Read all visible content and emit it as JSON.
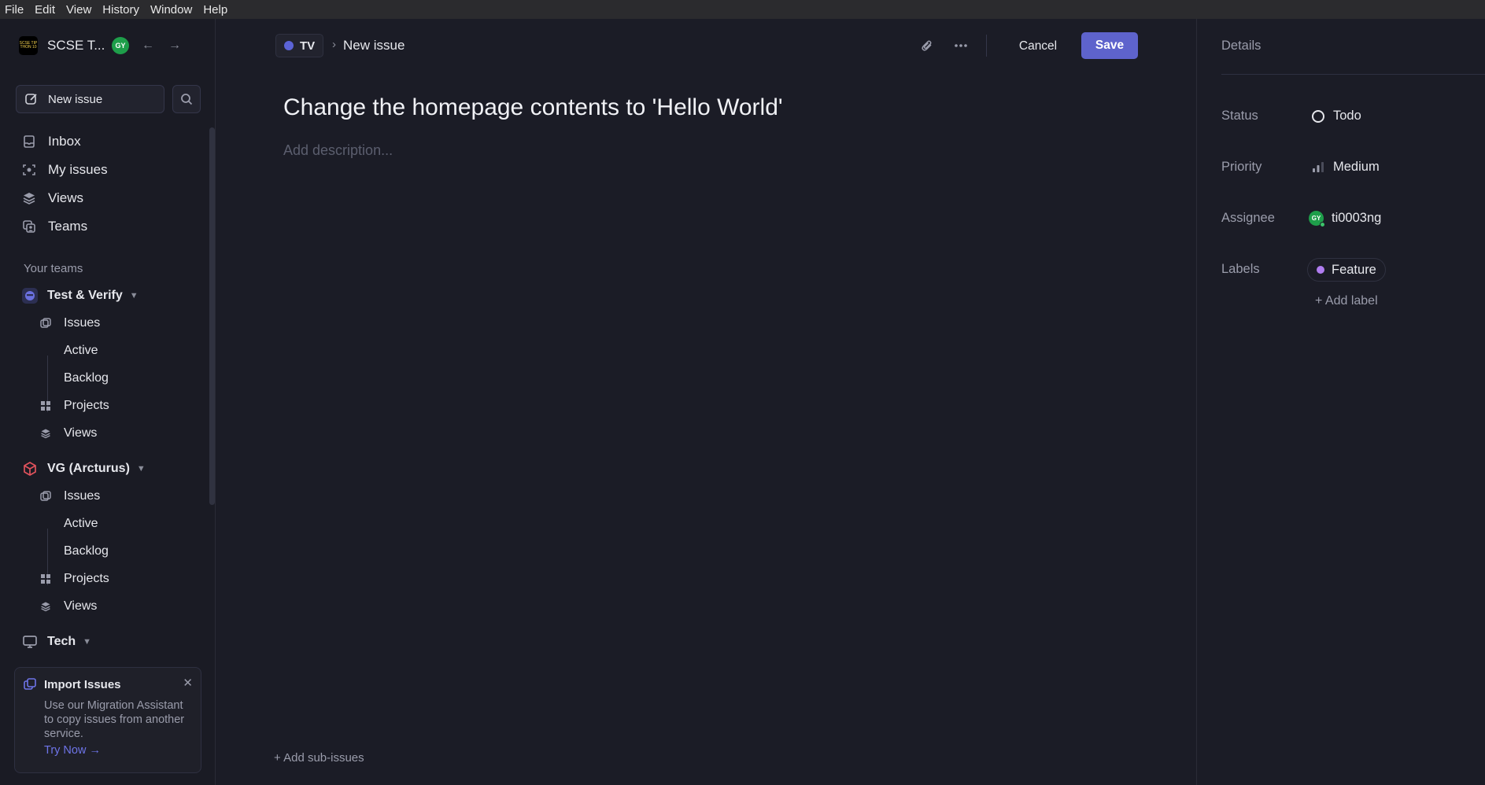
{
  "menubar": {
    "items": [
      "File",
      "Edit",
      "View",
      "History",
      "Window",
      "Help"
    ]
  },
  "sidebar": {
    "workspace": {
      "name": "SCSE T...",
      "logo_text": "SCSE TIP THON 10",
      "avatar": "GY"
    },
    "new_issue_label": "New issue",
    "nav": [
      {
        "label": "Inbox",
        "icon": "inbox-icon"
      },
      {
        "label": "My issues",
        "icon": "my-issues-icon"
      },
      {
        "label": "Views",
        "icon": "views-icon"
      },
      {
        "label": "Teams",
        "icon": "teams-icon"
      }
    ],
    "teams_section_label": "Your teams",
    "teams": [
      {
        "name": "Test & Verify",
        "items": [
          "Issues",
          "Active",
          "Backlog",
          "Projects",
          "Views"
        ]
      },
      {
        "name": "VG (Arcturus)",
        "items": [
          "Issues",
          "Active",
          "Backlog",
          "Projects",
          "Views"
        ]
      },
      {
        "name": "Tech"
      }
    ],
    "import_card": {
      "title": "Import Issues",
      "body": "Use our Migration Assistant to copy issues from another service.",
      "link": "Try Now →"
    }
  },
  "main": {
    "breadcrumb_team": "TV",
    "breadcrumb_sep": "›",
    "breadcrumb_page": "New issue",
    "cancel_label": "Cancel",
    "save_label": "Save",
    "issue_title": "Change the homepage contents to 'Hello World'",
    "description_placeholder": "Add description...",
    "add_sub_issues": "+ Add sub-issues"
  },
  "details": {
    "heading": "Details",
    "status": {
      "label": "Status",
      "value": "Todo"
    },
    "priority": {
      "label": "Priority",
      "value": "Medium"
    },
    "assignee": {
      "label": "Assignee",
      "value": "ti0003ng",
      "avatar": "GY"
    },
    "labels": {
      "label": "Labels",
      "value": "Feature",
      "color": "#b07df0"
    },
    "add_label": "+ Add label"
  },
  "colors": {
    "accent": "#5e63cc",
    "background": "#1b1c26",
    "sidebar": "#1a1b24",
    "avatar_green": "#1e9e4a"
  }
}
